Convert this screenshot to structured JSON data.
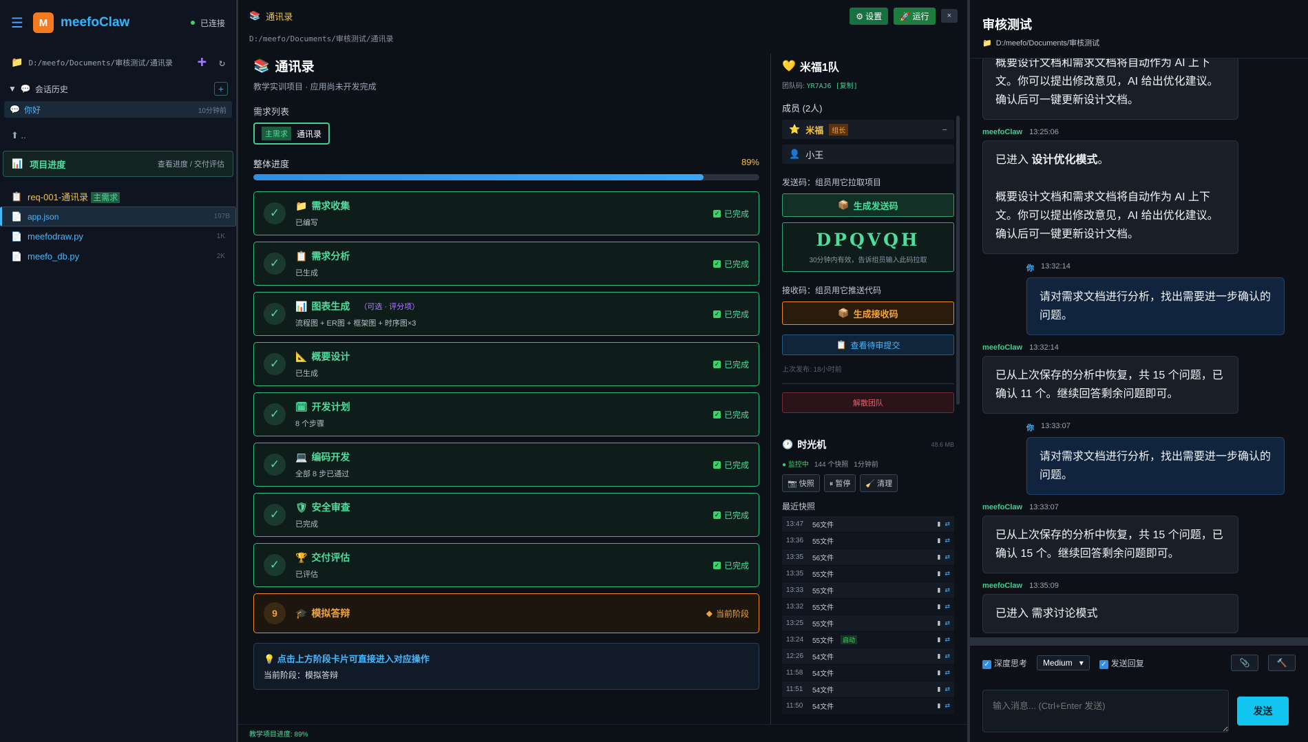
{
  "sidebar": {
    "brand": "meefoClaw",
    "status": "已连接",
    "path": "D:/meefo/Documents/审核测试/通讯录",
    "history_label": "会话历史",
    "session": {
      "title": "你好",
      "time": "10分钟前"
    },
    "up": "..",
    "project": {
      "title": "项目进度",
      "sub": "查看进度 / 交付评估"
    },
    "files": [
      {
        "name": "req-001-通讯录",
        "tag": "主需求",
        "size": ""
      },
      {
        "name": "app.json",
        "size": "197B"
      },
      {
        "name": "meefodraw.py",
        "size": "1K"
      },
      {
        "name": "meefo_db.py",
        "size": "2K"
      }
    ]
  },
  "center": {
    "tab_title": "通讯录",
    "settings_label": "⚙ 设置",
    "run_label": "🚀 运行",
    "close_label": "×",
    "path": "D:/meefo/Documents/审核测试/通讯录",
    "title": "通讯录",
    "subtitle": "教学实训项目 · 应用尚未开发完成",
    "req_list_label": "需求列表",
    "req_chip": {
      "tag": "主需求",
      "name": "通讯录"
    },
    "progress_label": "整体进度",
    "progress_text": "89%",
    "progress_value": 89,
    "stages": [
      {
        "icon": "📁",
        "name": "需求收集",
        "opt": "",
        "desc": "已编写",
        "status": "已完成"
      },
      {
        "icon": "📋",
        "name": "需求分析",
        "opt": "",
        "desc": "已生成",
        "status": "已完成"
      },
      {
        "icon": "📊",
        "name": "图表生成",
        "opt": "（可选 · 评分项）",
        "desc": "流程图 + ER图 + 框架图 + 时序图×3",
        "status": "已完成"
      },
      {
        "icon": "📐",
        "name": "概要设计",
        "opt": "",
        "desc": "已生成",
        "status": "已完成"
      },
      {
        "icon": "🗓",
        "name": "开发计划",
        "opt": "",
        "desc": "8 个步骤",
        "status": "已完成"
      },
      {
        "icon": "💻",
        "name": "编码开发",
        "opt": "",
        "desc": "全部 8 步已通过",
        "status": "已完成"
      },
      {
        "icon": "🛡",
        "name": "安全审查",
        "opt": "",
        "desc": "已完成",
        "status": "已完成"
      },
      {
        "icon": "🏆",
        "name": "交付评估",
        "opt": "",
        "desc": "已评估",
        "status": "已完成"
      }
    ],
    "current_stage": {
      "num": "9",
      "icon": "🎓",
      "name": "模拟答辩",
      "status": "当前阶段"
    },
    "tip": {
      "title": "点击上方阶段卡片可直接进入对应操作",
      "text": "当前阶段：模拟答辩"
    },
    "footer": "教学项目进度: 89%"
  },
  "team": {
    "name": "米福1队",
    "code_label": "团队码:",
    "code": "YR7AJ6 [复制]",
    "members_label": "成员 (2人)",
    "members": [
      {
        "name": "米福",
        "role": "组长"
      },
      {
        "name": "小王"
      }
    ],
    "send_label": "发送码：组员用它拉取项目",
    "gen_send": "生成发送码",
    "send_code": "DPQVQH",
    "send_hint": "30分钟内有效，告诉组员输入此码拉取",
    "recv_label": "接收码：组员用它推送代码",
    "gen_recv": "生成接收码",
    "pending": "查看待审提交",
    "last_pub": "上次发布: 18小时前",
    "dissolve": "解散团队"
  },
  "timemachine": {
    "title": "时光机",
    "size": "48.6 MB",
    "monitor": "监控中",
    "count": "144 个快照",
    "interval": "1分钟前",
    "btn_snap": "快照",
    "btn_pause": "暂停",
    "btn_clean": "清理",
    "recent_label": "最近快照",
    "snaps": [
      {
        "t": "13:47",
        "f": "56文件",
        "auto": ""
      },
      {
        "t": "13:36",
        "f": "55文件",
        "auto": ""
      },
      {
        "t": "13:35",
        "f": "56文件",
        "auto": ""
      },
      {
        "t": "13:35",
        "f": "55文件",
        "auto": ""
      },
      {
        "t": "13:33",
        "f": "55文件",
        "auto": ""
      },
      {
        "t": "13:32",
        "f": "55文件",
        "auto": ""
      },
      {
        "t": "13:25",
        "f": "55文件",
        "auto": ""
      },
      {
        "t": "13:24",
        "f": "55文件",
        "auto": "启动"
      },
      {
        "t": "12:26",
        "f": "54文件",
        "auto": ""
      },
      {
        "t": "11:58",
        "f": "54文件",
        "auto": ""
      },
      {
        "t": "11:51",
        "f": "54文件",
        "auto": ""
      },
      {
        "t": "11:50",
        "f": "54文件",
        "auto": ""
      }
    ]
  },
  "chat": {
    "title": "审核测试",
    "path": "D:/meefo/Documents/审核测试",
    "messages": [
      {
        "who": "",
        "time": "",
        "me": false,
        "lines": [
          "概要设计文档和需求文档将自动作为 AI 上下",
          "文。你可以提出修改意见，AI 给出优化建议。",
          "确认后可一键更新设计文档。"
        ]
      },
      {
        "who": "meefoClaw",
        "time": "13:25:06",
        "me": false,
        "lead": "已进入 ",
        "bold": "设计优化模式",
        "tail": "。",
        "lines": [
          "",
          "概要设计文档和需求文档将自动作为 AI 上下",
          "文。你可以提出修改意见，AI 给出优化建议。",
          "确认后可一键更新设计文档。"
        ]
      },
      {
        "who": "你",
        "time": "13:32:14",
        "me": true,
        "lines": [
          "请对需求文档进行分析，找出需要进一步确认的",
          "问题。"
        ]
      },
      {
        "who": "meefoClaw",
        "time": "13:32:14",
        "me": false,
        "lines": [
          "已从上次保存的分析中恢复，共 15 个问题，已",
          "确认 11 个。继续回答剩余问题即可。"
        ]
      },
      {
        "who": "你",
        "time": "13:33:07",
        "me": true,
        "lines": [
          "请对需求文档进行分析，找出需要进一步确认的",
          "问题。"
        ]
      },
      {
        "who": "meefoClaw",
        "time": "13:33:07",
        "me": false,
        "lines": [
          "已从上次保存的分析中恢复，共 15 个问题，已",
          "确认 15 个。继续回答剩余问题即可。"
        ]
      },
      {
        "who": "meefoClaw",
        "time": "13:35:09",
        "me": false,
        "lines": [
          "已进入 需求讨论模式"
        ]
      }
    ],
    "deep_think": "深度思考",
    "level": "Medium",
    "send_reply": "发送回复",
    "placeholder": "输入消息... (Ctrl+Enter 发送)",
    "send": "发送"
  },
  "colors": {
    "accent": "#46b8ff",
    "success": "#4ddd9d",
    "warning": "#f4a33a",
    "danger": "#f25a6a"
  }
}
